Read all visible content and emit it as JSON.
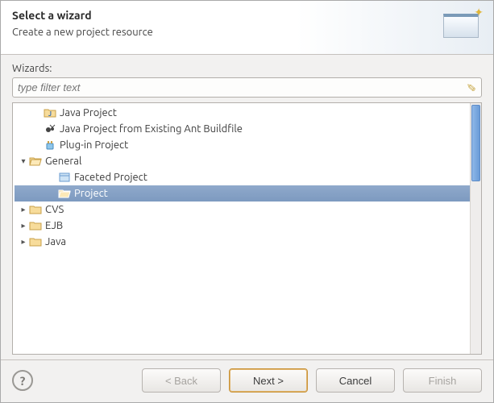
{
  "header": {
    "title": "Select a wizard",
    "subtitle": "Create a new project resource"
  },
  "wizards_label": "Wizards:",
  "filter": {
    "placeholder": "type filter text"
  },
  "tree": [
    {
      "id": "java-project",
      "label": "Java Project",
      "depth": 1,
      "arrow": "none",
      "icon": "java-project-icon",
      "selected": false
    },
    {
      "id": "java-ant",
      "label": "Java Project from Existing Ant Buildfile",
      "depth": 1,
      "arrow": "none",
      "icon": "ant-icon",
      "selected": false
    },
    {
      "id": "plugin-project",
      "label": "Plug-in Project",
      "depth": 1,
      "arrow": "none",
      "icon": "plugin-icon",
      "selected": false
    },
    {
      "id": "general",
      "label": "General",
      "depth": 0,
      "arrow": "down",
      "icon": "folder-open-icon",
      "selected": false
    },
    {
      "id": "faceted",
      "label": "Faceted Project",
      "depth": 2,
      "arrow": "none",
      "icon": "facet-icon",
      "selected": false
    },
    {
      "id": "project",
      "label": "Project",
      "depth": 2,
      "arrow": "none",
      "icon": "project-icon",
      "selected": true
    },
    {
      "id": "cvs",
      "label": "CVS",
      "depth": 0,
      "arrow": "right",
      "icon": "folder-icon",
      "selected": false
    },
    {
      "id": "ejb",
      "label": "EJB",
      "depth": 0,
      "arrow": "right",
      "icon": "folder-icon",
      "selected": false
    },
    {
      "id": "java-cat",
      "label": "Java",
      "depth": 0,
      "arrow": "right",
      "icon": "folder-icon",
      "selected": false
    }
  ],
  "buttons": {
    "back": "< Back",
    "next": "Next >",
    "cancel": "Cancel",
    "finish": "Finish"
  }
}
